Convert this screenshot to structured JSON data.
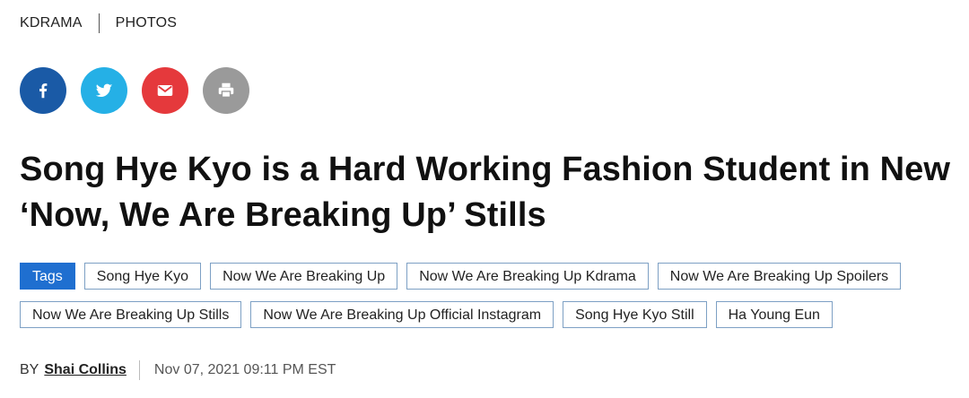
{
  "breadcrumb": {
    "category": "KDRAMA",
    "subcategory": "PHOTOS"
  },
  "share": {
    "buttons": [
      {
        "name": "facebook",
        "icon": "facebook-icon",
        "color": "#1a5aa6"
      },
      {
        "name": "twitter",
        "icon": "twitter-icon",
        "color": "#25b0e6"
      },
      {
        "name": "email",
        "icon": "email-icon",
        "color": "#e5393c"
      },
      {
        "name": "print",
        "icon": "print-icon",
        "color": "#9a9a9a"
      }
    ]
  },
  "article": {
    "title": "Song Hye Kyo is a Hard Working Fashion Student in New ‘Now, We Are Breaking Up’ Stills"
  },
  "tags": {
    "label": "Tags",
    "items": [
      "Song Hye Kyo",
      "Now We Are Breaking Up",
      "Now We Are Breaking Up Kdrama",
      "Now We Are Breaking Up Spoilers",
      "Now We Are Breaking Up Stills",
      "Now We Are Breaking Up Official Instagram",
      "Song Hye Kyo Still",
      "Ha Young Eun"
    ]
  },
  "byline": {
    "by": "BY",
    "author": "Shai Collins",
    "date": "Nov 07, 2021 09:11 PM EST"
  },
  "colors": {
    "tag_accent": "#1f6fd0",
    "tag_border": "#7da0c4"
  }
}
